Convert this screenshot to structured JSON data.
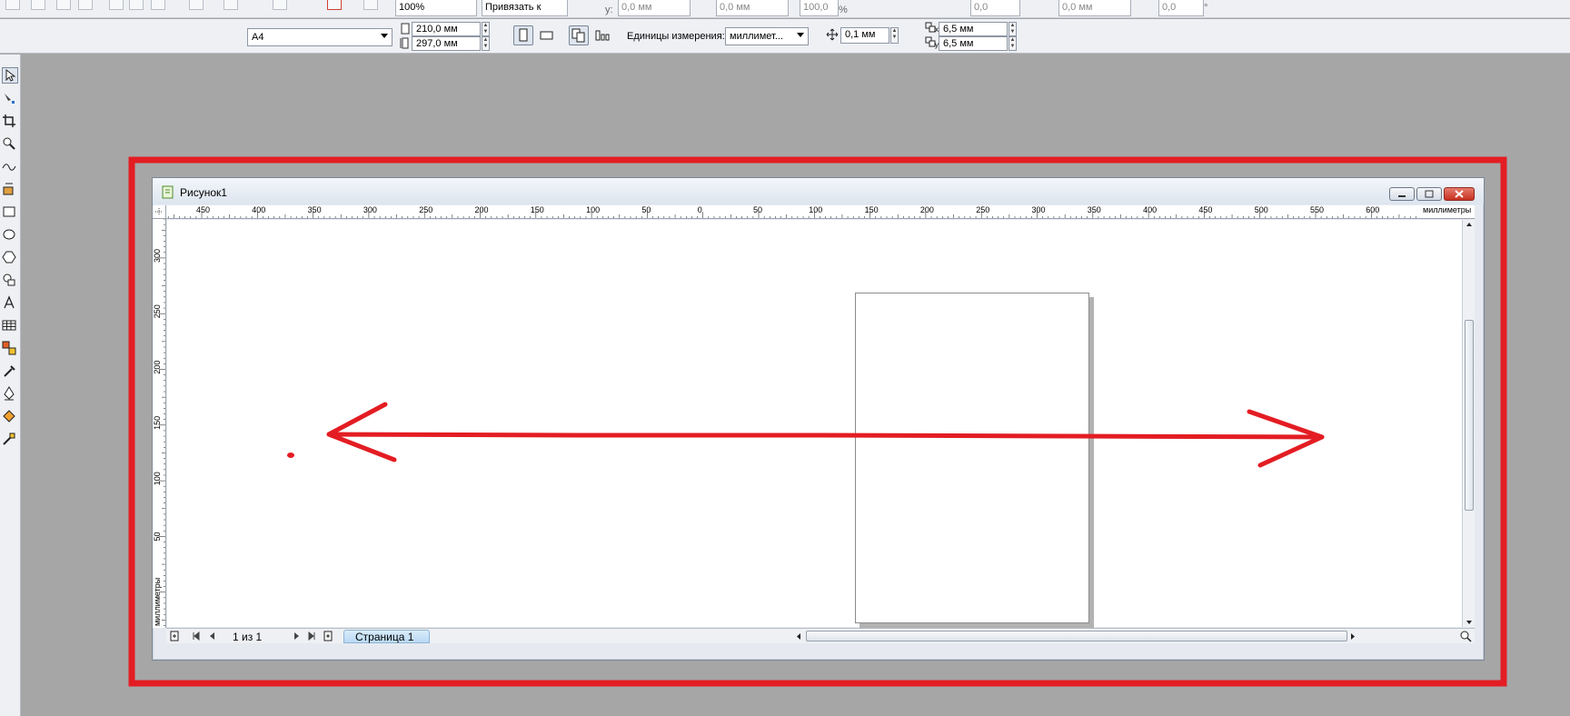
{
  "top_toolbar": {
    "zoom_value": "100%",
    "snap_label": "Привязать к",
    "y_label": "y:",
    "y_value": "0,0 мм",
    "height_value": "0,0 мм",
    "scale_value": "100,0",
    "scale_unit": "%",
    "rotate_value": "0,0",
    "pos_value": "0,0 мм",
    "skew_value": "0,0",
    "degree_unit": "°"
  },
  "property_bar": {
    "paper_size": "A4",
    "width": "210,0 мм",
    "height": "297,0 мм",
    "units_label": "Единицы измерения:",
    "units_value": "миллимет...",
    "nudge": "0,1 мм",
    "dup_x": "6,5 мм",
    "dup_y": "6,5 мм",
    "x_sub": "x",
    "y_sub": "y"
  },
  "document": {
    "title": "Рисунок1",
    "h_ruler_unit": "миллиметры",
    "v_ruler_unit": "миллиметры",
    "h_ticks": [
      "450",
      "400",
      "350",
      "300",
      "250",
      "200",
      "150",
      "100",
      "50",
      "0",
      "50",
      "100",
      "150",
      "200",
      "250",
      "300",
      "350",
      "400",
      "450",
      "500",
      "550",
      "600"
    ],
    "v_ticks": [
      "300",
      "250",
      "200",
      "150",
      "100",
      "50"
    ],
    "page_counter": "1 из 1",
    "page_tab": "Страница 1"
  },
  "colors": {
    "annotation_red": "#e31d23",
    "workspace_gray": "#a6a6a6"
  }
}
